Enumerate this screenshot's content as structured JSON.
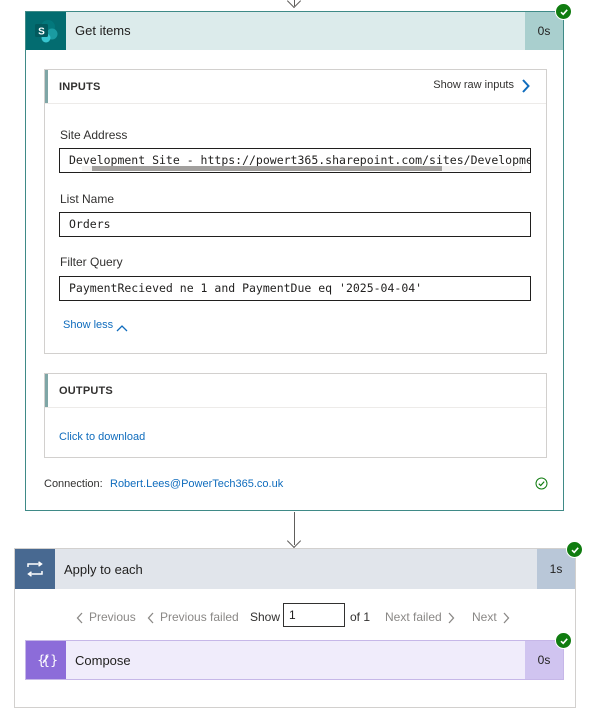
{
  "get_items": {
    "title": "Get items",
    "duration": "0s",
    "status": "succeeded",
    "inputs": {
      "header": "INPUTS",
      "show_raw": "Show raw inputs",
      "fields": [
        {
          "label": "Site Address",
          "value": "Development Site - https://powert365.sharepoint.com/sites/Developme"
        },
        {
          "label": "List Name",
          "value": "Orders"
        },
        {
          "label": "Filter Query",
          "value": "PaymentRecieved ne 1 and PaymentDue eq '2025-04-04'"
        }
      ],
      "show_less": "Show less"
    },
    "outputs": {
      "header": "OUTPUTS",
      "download": "Click to download"
    },
    "connection": {
      "label": "Connection:",
      "value": "Robert.Lees@PowerTech365.co.uk"
    }
  },
  "apply_to_each": {
    "title": "Apply to each",
    "duration": "1s",
    "status": "succeeded",
    "pager": {
      "previous": "Previous",
      "previous_failed": "Previous failed",
      "show": "Show",
      "current": "1",
      "of": "of 1",
      "next_failed": "Next failed",
      "next": "Next"
    }
  },
  "compose": {
    "title": "Compose",
    "duration": "0s",
    "status": "succeeded"
  },
  "colors": {
    "sharepoint": "#036c70",
    "loop": "#486991",
    "compose": "#8c6cd9",
    "success": "#107c10",
    "link": "#0f6cbd"
  }
}
